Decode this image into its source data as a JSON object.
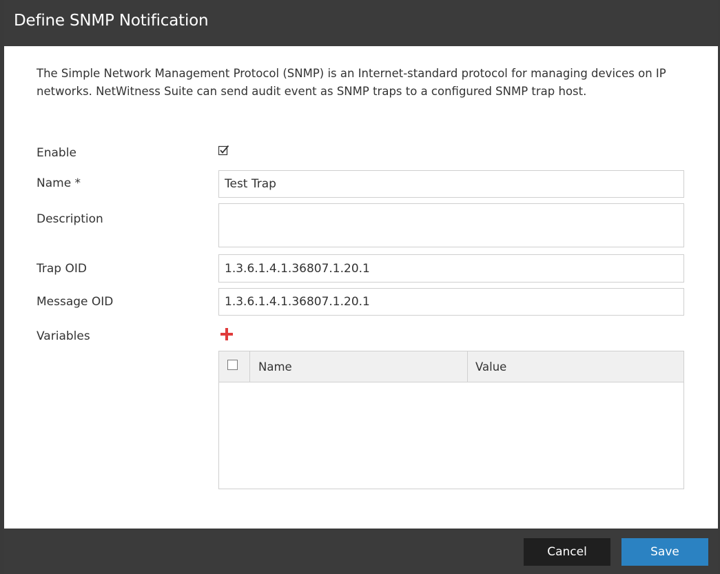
{
  "dialog": {
    "title": "Define SNMP Notification",
    "intro": "The Simple Network Management Protocol (SNMP) is an Internet-standard protocol for managing devices on IP networks. NetWitness Suite can send audit event as SNMP traps to a configured SNMP trap host."
  },
  "form": {
    "enable_label": "Enable",
    "enable_checked": true,
    "name_label": "Name *",
    "name_value": "Test Trap",
    "description_label": "Description",
    "description_value": "",
    "trap_oid_label": "Trap OID",
    "trap_oid_value": "1.3.6.1.4.1.36807.1.20.1",
    "message_oid_label": "Message OID",
    "message_oid_value": "1.3.6.1.4.1.36807.1.20.1",
    "variables_label": "Variables"
  },
  "variables_table": {
    "columns": [
      "Name",
      "Value"
    ],
    "rows": []
  },
  "icons": {
    "add": "plus-icon",
    "enable": "checkbox-checked-icon",
    "select_all": "checkbox-icon"
  },
  "footer": {
    "cancel_label": "Cancel",
    "save_label": "Save"
  },
  "colors": {
    "titlebar": "#3b3b3b",
    "add_icon": "#e03b3b",
    "save_button": "#2b82c2",
    "cancel_button": "#1f1f1f"
  }
}
